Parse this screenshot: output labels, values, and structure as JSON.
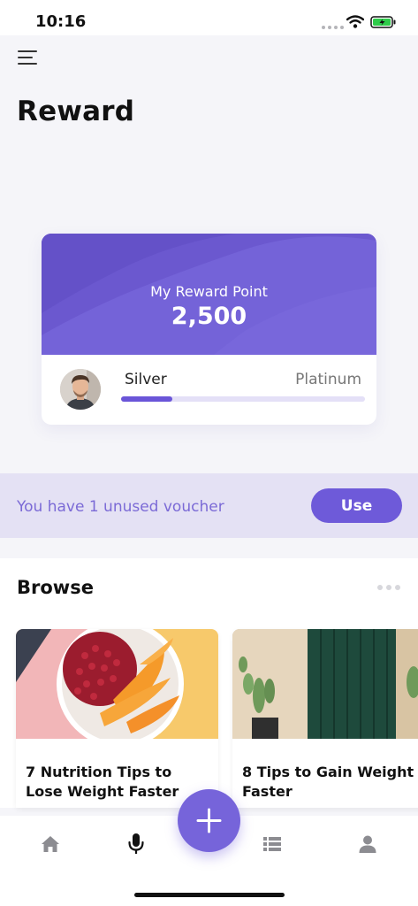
{
  "status_bar": {
    "time": "10:16"
  },
  "header": {
    "title": "Reward"
  },
  "reward_card": {
    "label": "My Reward Point",
    "points": "2,500",
    "current_tier": "Silver",
    "next_tier": "Platinum",
    "progress_fraction": 0.21
  },
  "voucher": {
    "text": "You have 1 unused voucher",
    "button_label": "Use"
  },
  "browse": {
    "title": "Browse",
    "articles": [
      {
        "title": "7 Nutrition Tips to Lose Weight Faster"
      },
      {
        "title": "8 Tips to Gain Weight Faster"
      }
    ]
  },
  "tab_bar": {
    "items": [
      "home-icon",
      "microphone-icon",
      "plus-icon",
      "list-icon",
      "profile-icon"
    ]
  },
  "colors": {
    "accent": "#6e5ad9",
    "card_gradient": "#7462d8",
    "voucher_bg": "#e4e1f4"
  }
}
